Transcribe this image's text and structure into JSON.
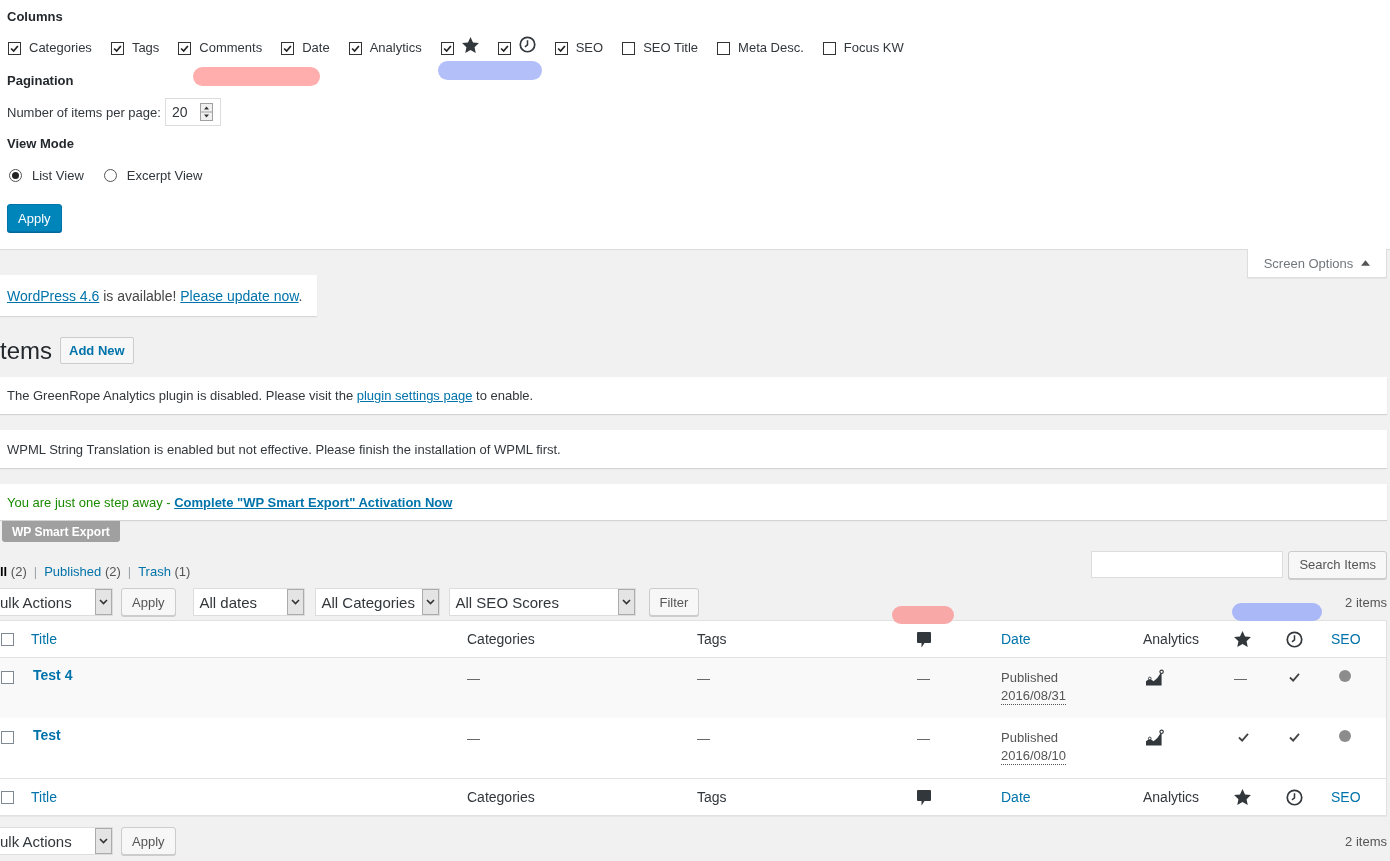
{
  "screen_options": {
    "columns_heading": "Columns",
    "columns": [
      {
        "kind": "text",
        "label": "Categories",
        "checked": true
      },
      {
        "kind": "text",
        "label": "Tags",
        "checked": true
      },
      {
        "kind": "text",
        "label": "Comments",
        "checked": true
      },
      {
        "kind": "text",
        "label": "Date",
        "checked": true
      },
      {
        "kind": "text",
        "label": "Analytics",
        "checked": true
      },
      {
        "kind": "star",
        "checked": true
      },
      {
        "kind": "clock",
        "checked": true
      },
      {
        "kind": "text",
        "label": "SEO",
        "checked": true
      },
      {
        "kind": "text",
        "label": "SEO Title",
        "checked": false
      },
      {
        "kind": "text",
        "label": "Meta Desc.",
        "checked": false
      },
      {
        "kind": "text",
        "label": "Focus KW",
        "checked": false
      }
    ],
    "pagination_heading": "Pagination",
    "per_page_label": "Number of items per page:",
    "per_page_value": "20",
    "view_mode_heading": "View Mode",
    "view_modes": [
      {
        "label": "List View",
        "selected": true
      },
      {
        "label": "Excerpt View",
        "selected": false
      }
    ],
    "apply_button": "Apply"
  },
  "screen_options_tab": {
    "label": "Screen Options",
    "expanded": true
  },
  "update_notice": {
    "segments": [
      {
        "kind": "link",
        "text": "WordPress 4.6"
      },
      {
        "kind": "text",
        "text": " is available! "
      },
      {
        "kind": "link",
        "text": "Please update now"
      },
      {
        "kind": "text",
        "text": "."
      }
    ]
  },
  "page_title": "tems",
  "add_new_button": "Add New",
  "notices": [
    {
      "success": false,
      "segments": [
        {
          "kind": "text",
          "text": "The GreenRope Analytics plugin is disabled. Please visit the "
        },
        {
          "kind": "link",
          "text": "plugin settings page"
        },
        {
          "kind": "text",
          "text": " to enable."
        }
      ]
    },
    {
      "success": false,
      "segments": [
        {
          "kind": "text",
          "text": "WPML String Translation is enabled but not effective. Please finish the installation of WPML first."
        }
      ]
    },
    {
      "success": true,
      "segments": [
        {
          "kind": "text",
          "text": "You are just one step away - "
        },
        {
          "kind": "bold-link",
          "text": "Complete \"WP Smart Export\" Activation Now"
        }
      ]
    }
  ],
  "export_tag": "WP Smart Export",
  "views": [
    {
      "label": "ll",
      "count": "(2)",
      "selected": true
    },
    {
      "label": "Published",
      "count": "(2)",
      "selected": false
    },
    {
      "label": "Trash",
      "count": "(1)",
      "selected": false
    }
  ],
  "view_separators": [
    "|",
    "|"
  ],
  "search_button": "Search Items",
  "top_actions": {
    "bulk_actions": "ulk Actions",
    "apply": "Apply",
    "date_filter": "All dates",
    "category_filter": "All Categories",
    "seo_filter": "All SEO Scores",
    "filter_button": "Filter",
    "item_count": "2 items"
  },
  "table": {
    "columns": [
      {
        "kind": "checkbox",
        "checked": false
      },
      {
        "kind": "link",
        "label": "Title"
      },
      {
        "kind": "text",
        "label": "Categories"
      },
      {
        "kind": "text",
        "label": "Tags"
      },
      {
        "kind": "comment"
      },
      {
        "kind": "link",
        "label": "Date"
      },
      {
        "kind": "text",
        "label": "Analytics"
      },
      {
        "kind": "star"
      },
      {
        "kind": "clock"
      },
      {
        "kind": "link",
        "label": "SEO"
      }
    ],
    "rows": [
      {
        "cells": [
          {
            "kind": "checkbox",
            "checked": false
          },
          {
            "kind": "title",
            "text": "Test 4"
          },
          {
            "kind": "text",
            "text": "—"
          },
          {
            "kind": "text",
            "text": "—"
          },
          {
            "kind": "text",
            "text": "—"
          },
          {
            "kind": "date",
            "status": "Published",
            "date": "2016/08/31"
          },
          {
            "kind": "chart"
          },
          {
            "kind": "text",
            "text": "—"
          },
          {
            "kind": "check"
          },
          {
            "kind": "dot",
            "color": "#8c8c8c"
          }
        ]
      },
      {
        "cells": [
          {
            "kind": "checkbox",
            "checked": false
          },
          {
            "kind": "title",
            "text": "Test"
          },
          {
            "kind": "text",
            "text": "—"
          },
          {
            "kind": "text",
            "text": "—"
          },
          {
            "kind": "text",
            "text": "—"
          },
          {
            "kind": "date",
            "status": "Published",
            "date": "2016/08/10"
          },
          {
            "kind": "chart"
          },
          {
            "kind": "check"
          },
          {
            "kind": "check"
          },
          {
            "kind": "dot",
            "color": "#8c8c8c"
          }
        ]
      }
    ],
    "footer_columns": [
      {
        "kind": "checkbox",
        "checked": false
      },
      {
        "kind": "link",
        "label": "Title"
      },
      {
        "kind": "text",
        "label": "Categories"
      },
      {
        "kind": "text",
        "label": "Tags"
      },
      {
        "kind": "comment"
      },
      {
        "kind": "link",
        "label": "Date"
      },
      {
        "kind": "text",
        "label": "Analytics"
      },
      {
        "kind": "star"
      },
      {
        "kind": "clock"
      },
      {
        "kind": "link",
        "label": "SEO"
      }
    ]
  },
  "bottom_actions": {
    "bulk_actions": "ulk Actions",
    "apply": "Apply",
    "item_count": "2 items"
  },
  "annotations": [
    {
      "color": "#ffadad"
    },
    {
      "color": "#b3bff9"
    },
    {
      "color": "#f9a8a8"
    },
    {
      "color": "#aab8f7"
    }
  ]
}
